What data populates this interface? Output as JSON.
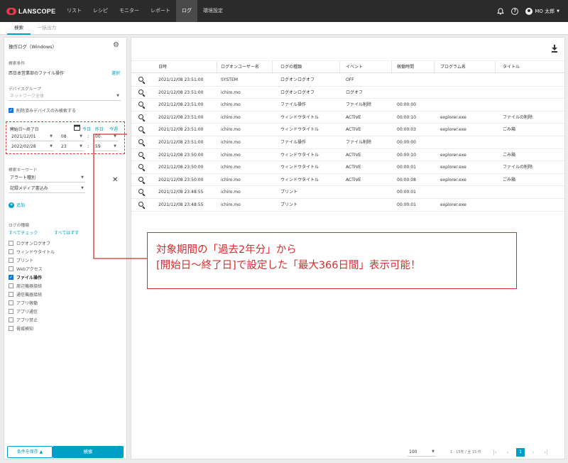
{
  "app": {
    "logo_text": "LANSCOPE",
    "nav": [
      {
        "label": "リスト"
      },
      {
        "label": "レシピ"
      },
      {
        "label": "モニター"
      },
      {
        "label": "レポート"
      },
      {
        "label": "ログ"
      },
      {
        "label": "環境設定"
      }
    ],
    "active_nav": "ログ",
    "user_label": "MO 太郎",
    "help_glyph": "?"
  },
  "subtabs": [
    {
      "label": "検索"
    },
    {
      "label": "一括出力"
    }
  ],
  "sidebar": {
    "title": "操作ログ（Windows）",
    "search_condition_label": "検索条件",
    "search_condition_value": "西日本営業部のファイル操作",
    "select_link": "選択",
    "device_group_label": "デバイスグループ",
    "device_group_value": "ネットワーク全体",
    "deleted_devices_label": "削除済みデバイスのみ検索する",
    "period_label": "開始日～終了日",
    "today_link": "今日",
    "yesterday_link": "昨日",
    "this_month_link": "今週",
    "start": {
      "date": "2021/12/01",
      "hour": "08",
      "minute": "00"
    },
    "end": {
      "date": "2022/02/28",
      "hour": "23",
      "minute": "59"
    },
    "keyword_label": "検索キーワード",
    "keyword_type": "アラート種別",
    "keyword_value": "記録メディア書込み",
    "add_label": "追加",
    "log_type_label": "ログの種類",
    "check_all": "すべてチェック",
    "uncheck_all": "すべてはずす",
    "log_types": [
      {
        "label": "ログオンログオフ",
        "checked": false
      },
      {
        "label": "ウィンドウタイトル",
        "checked": false
      },
      {
        "label": "プリント",
        "checked": false
      },
      {
        "label": "Webアクセス",
        "checked": false
      },
      {
        "label": "ファイル操作",
        "checked": true
      },
      {
        "label": "周辺機器接続",
        "checked": false
      },
      {
        "label": "通信機器接続",
        "checked": false
      },
      {
        "label": "アプリ稼働",
        "checked": false
      },
      {
        "label": "アプリ通信",
        "checked": false
      },
      {
        "label": "アプリ禁止",
        "checked": false
      },
      {
        "label": "脅威検知",
        "checked": false
      }
    ],
    "save_button": "条件を保存 ▲",
    "search_button": "検索"
  },
  "table": {
    "columns": [
      "日時",
      "ログオンユーザー名",
      "ログの種類",
      "イベント",
      "稼働時間",
      "プログラム名",
      "タイトル"
    ],
    "rows": [
      [
        "2021/12/08 23:51:00",
        "SYSTEM",
        "ログオンログオフ",
        "OFF",
        "",
        "",
        ""
      ],
      [
        "2021/12/08 23:51:00",
        "ichiro.mo",
        "ログオンログオフ",
        "ログオフ",
        "",
        "",
        ""
      ],
      [
        "2021/12/08 23:51:00",
        "ichiro.mo",
        "ファイル操作",
        "ファイル削除",
        "00:00:00",
        "",
        ""
      ],
      [
        "2021/12/08 23:51:00",
        "ichiro.mo",
        "ウィンドウタイトル",
        "ACTIVE",
        "00:00:10",
        "explorer.exe",
        "ファイルの削除"
      ],
      [
        "2021/12/08 23:51:00",
        "ichiro.mo",
        "ウィンドウタイトル",
        "ACTIVE",
        "00:00:03",
        "explorer.exe",
        "ごみ箱"
      ],
      [
        "2021/12/08 23:51:00",
        "ichiro.mo",
        "ファイル操作",
        "ファイル削除",
        "00:00:00",
        "",
        ""
      ],
      [
        "2021/12/08 23:50:00",
        "ichiro.mo",
        "ウィンドウタイトル",
        "ACTIVE",
        "00:00:10",
        "explorer.exe",
        "ごみ箱"
      ],
      [
        "2021/12/08 23:50:00",
        "ichiro.mo",
        "ウィンドウタイトル",
        "ACTIVE",
        "00:00:01",
        "explorer.exe",
        "ファイルの削除"
      ],
      [
        "2021/12/08 23:50:00",
        "ichiro.mo",
        "ウィンドウタイトル",
        "ACTIVE",
        "00:00:08",
        "explorer.exe",
        "ごみ箱"
      ],
      [
        "2021/12/08 23:48:55",
        "ichiro.mo",
        "プリント",
        "",
        "00:00:01",
        "",
        ""
      ],
      [
        "2021/12/08 23:48:55",
        "ichiro.mo",
        "プリント",
        "",
        "00:00:01",
        "explorer.exe",
        ""
      ]
    ],
    "per_page": "100",
    "range_text": "1 - 15件 / 全 15 件",
    "current_page": "1"
  },
  "annotation": {
    "line1": "対象期間の「過去2年分」から",
    "line2": "[開始日～終了日]で設定した「最大366日間」表示可能！",
    "color": "#d32f2f"
  },
  "colors": {
    "accent": "#00a0c6",
    "header_bg": "#2b2b2b",
    "check": "#1976d2"
  }
}
